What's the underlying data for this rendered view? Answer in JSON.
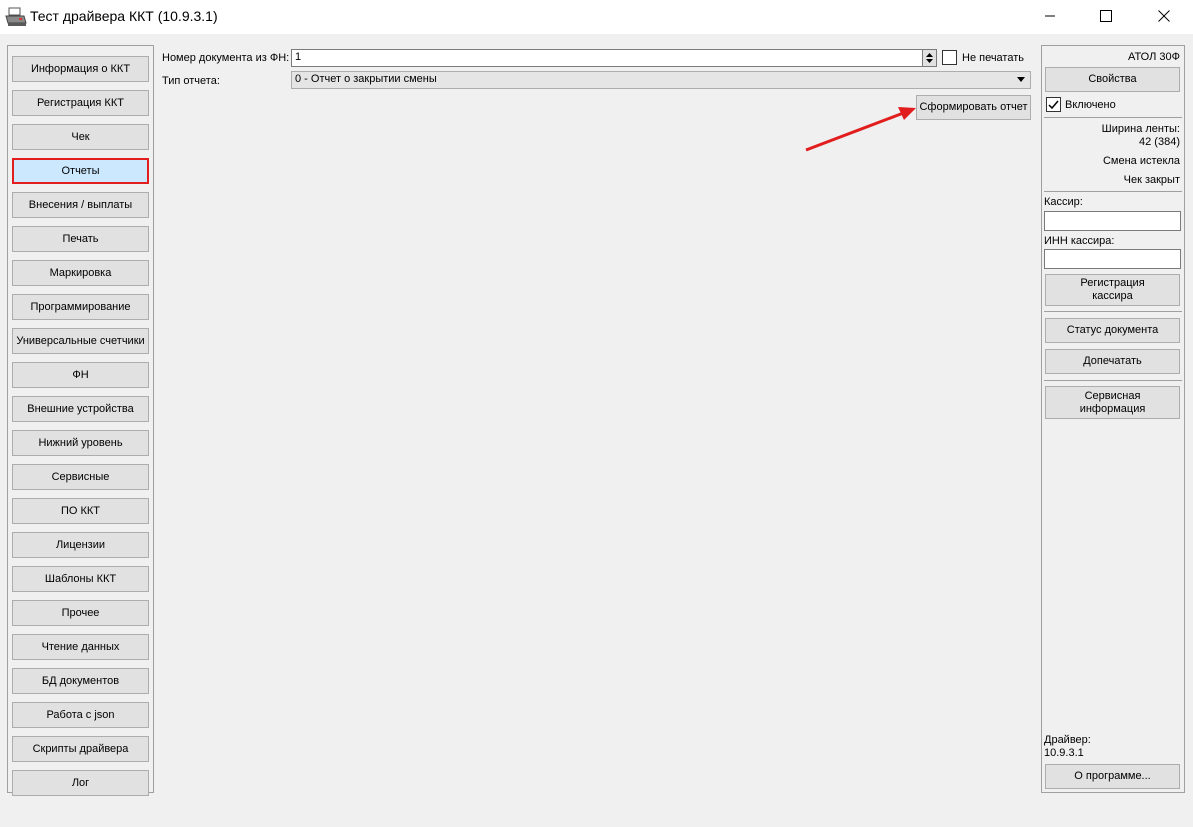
{
  "window": {
    "title": "Тест драйвера ККТ (10.9.3.1)"
  },
  "sidebar": {
    "items": [
      {
        "label": "Информация о ККТ"
      },
      {
        "label": "Регистрация ККТ"
      },
      {
        "label": "Чек"
      },
      {
        "label": "Отчеты",
        "selected": true
      },
      {
        "label": "Внесения / выплаты"
      },
      {
        "label": "Печать"
      },
      {
        "label": "Маркировка"
      },
      {
        "label": "Программирование"
      },
      {
        "label": "Универсальные счетчики"
      },
      {
        "label": "ФН"
      },
      {
        "label": "Внешние устройства"
      },
      {
        "label": "Нижний уровень"
      },
      {
        "label": "Сервисные"
      },
      {
        "label": "ПО ККТ"
      },
      {
        "label": "Лицензии"
      },
      {
        "label": "Шаблоны ККТ"
      },
      {
        "label": "Прочее"
      },
      {
        "label": "Чтение данных"
      },
      {
        "label": "БД документов"
      },
      {
        "label": "Работа с json"
      },
      {
        "label": "Скрипты драйвера"
      },
      {
        "label": "Лог"
      }
    ]
  },
  "main": {
    "doc_number_label": "Номер документа из ФН:",
    "doc_number_value": "1",
    "no_print_label": "Не печатать",
    "no_print_checked": false,
    "report_type_label": "Тип отчета:",
    "report_type_value": "0 - Отчет о закрытии смены",
    "generate_button": "Сформировать отчет"
  },
  "right_panel": {
    "device_name": "АТОЛ 30Ф",
    "properties_button": "Свойства",
    "enabled_label": "Включено",
    "enabled_checked": true,
    "tape_width_label": "Ширина ленты:",
    "tape_width_value": "42 (384)",
    "shift_status": "Смена истекла",
    "receipt_status": "Чек закрыт",
    "cashier_label": "Кассир:",
    "cashier_value": "",
    "cashier_inn_label": "ИНН кассира:",
    "cashier_inn_value": "",
    "register_cashier_line1": "Регистрация",
    "register_cashier_line2": "кассира",
    "doc_status_button": "Статус документа",
    "reprint_button": "Допечатать",
    "service_info_line1": "Сервисная",
    "service_info_line2": "информация",
    "driver_label": "Драйвер:",
    "driver_version": "10.9.3.1",
    "about_button": "О программе..."
  },
  "colors": {
    "highlight_border": "#e11d1d",
    "selected_background": "#cce8ff",
    "annotation_arrow": "#e11d1d"
  }
}
